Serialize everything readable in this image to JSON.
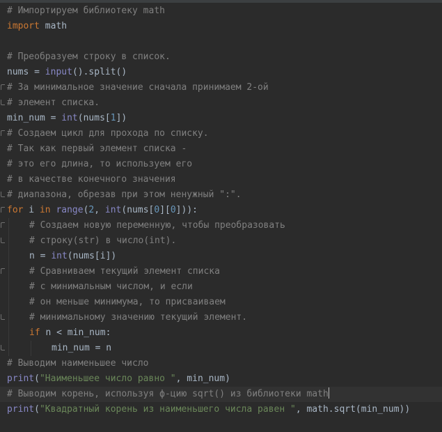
{
  "lines": [
    "# Импортируем библиотеку math",
    "math",
    "# Преобразуем строку в список.",
    "nums = ",
    "# За минимальное значение сначала принимаем 2-ой",
    "# элемент списка.",
    "min_num = ",
    "# Создаем цикл для прохода по списку.",
    "# Так как первый элемент списка -",
    "# это его длина, то используем его",
    "# в качестве конечного значения",
    "# диапазона, обрезав при этом ненужный \":\".",
    "# Создаем новую переменную, чтобы преобразовать",
    "# строку(str) в число(int).",
    "n = ",
    "# Сравниваем текущий элемент списка",
    "# с минимальным числом, и если",
    "# он меньше минимума, то присваиваем",
    "# минимальному значению текущий элемент.",
    "min_num = n",
    "# Выводим наименьшее число",
    "# Выводим корень, используя ф-цию sqrt() из библиотеки math"
  ],
  "tokens": {
    "import": "import",
    "input": "input",
    "split_call": "().split()",
    "int": "int",
    "nums_idx_1": "(nums[",
    "one": "1",
    "close_br_paren": "])",
    "for": "for",
    "i": " i ",
    "in": "in",
    "range": "range",
    "open_paren": "(",
    "two": "2",
    "comma": ", ",
    "nums_open": "(nums[",
    "zero": "0",
    "br_mid": "][",
    "for_close": "])):",
    "nums_i": "(nums[i])",
    "if": "if",
    "cond": " n < min_num:",
    "print": "print",
    "str_min": "\"Наименьшее число равно \"",
    "print_min_rest": ", min_num)",
    "str_sqrt": "\"Квадратный корень из наименьшего числа равен \"",
    "print_sqrt_rest": ", math.sqrt(min_num))"
  }
}
